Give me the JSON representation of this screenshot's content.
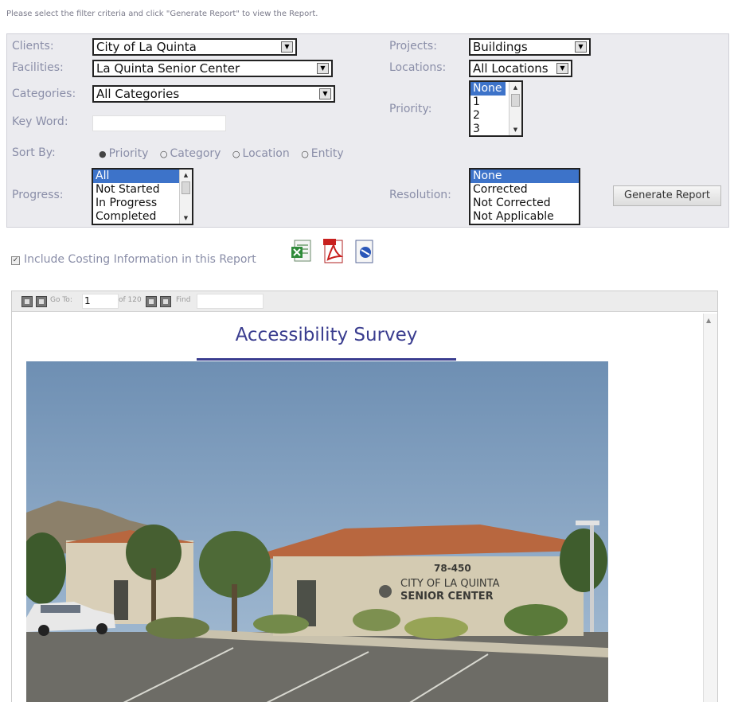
{
  "instruction": "Please select the filter criteria and click \"Generate Report\" to view the Report.",
  "filters": {
    "clients": {
      "label": "Clients:",
      "value": "City of La Quinta"
    },
    "facilities": {
      "label": "Facilities:",
      "value": "La Quinta Senior Center"
    },
    "categories": {
      "label": "Categories:",
      "value": "All Categories"
    },
    "keyword": {
      "label": "Key Word:",
      "value": ""
    },
    "projects": {
      "label": "Projects:",
      "value": "Buildings"
    },
    "locations": {
      "label": "Locations:",
      "value": "All Locations"
    },
    "priority": {
      "label": "Priority:",
      "options": [
        "None",
        "1",
        "2",
        "3"
      ],
      "selected": "None"
    },
    "sort_by": {
      "label": "Sort By:",
      "options": [
        "Priority",
        "Category",
        "Location",
        "Entity"
      ],
      "selected": "Priority"
    },
    "progress": {
      "label": "Progress:",
      "options": [
        "All",
        "Not Started",
        "In Progress",
        "Completed"
      ],
      "selected": "All"
    },
    "resolution": {
      "label": "Resolution:",
      "options": [
        "None",
        "Corrected",
        "Not Corrected",
        "Not Applicable"
      ],
      "selected": "None"
    }
  },
  "generate_button": "Generate Report",
  "costing": {
    "label": "Include Costing Information in this Report",
    "checked": true
  },
  "export_icons": [
    "excel-icon",
    "pdf-icon",
    "word-icon"
  ],
  "toolbar": {
    "goto_label": "Go To:",
    "page_value": "1",
    "of_label": "of 120",
    "find_label": "Find"
  },
  "report": {
    "title": "Accessibility Survey",
    "photo_sign_number": "78-450",
    "photo_sign_line1": "CITY OF LA QUINTA",
    "photo_sign_line2": "SENIOR CENTER"
  },
  "colors": {
    "label": "#8a8ea8",
    "selection": "#3d73c9",
    "title": "#3a3d8f",
    "panel": "#ebebef"
  }
}
